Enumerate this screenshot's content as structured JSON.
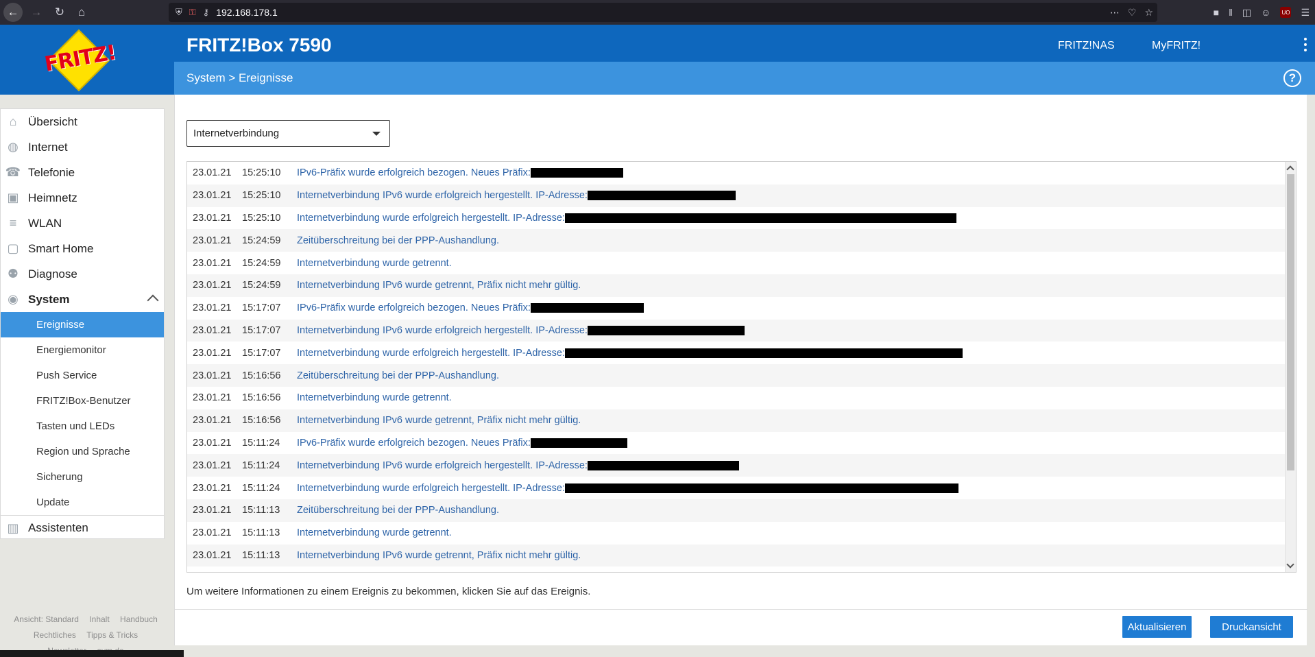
{
  "browser": {
    "url": "192.168.178.1"
  },
  "header": {
    "logo_text": "FRITZ!",
    "product": "FRITZ!Box 7590",
    "links": [
      "FRITZ!NAS",
      "MyFRITZ!"
    ],
    "breadcrumb": "System > Ereignisse",
    "help": "?"
  },
  "sidebar": {
    "items": [
      {
        "label": "Übersicht",
        "icon": "home-icon"
      },
      {
        "label": "Internet",
        "icon": "globe-icon"
      },
      {
        "label": "Telefonie",
        "icon": "phone-icon"
      },
      {
        "label": "Heimnetz",
        "icon": "network-icon"
      },
      {
        "label": "WLAN",
        "icon": "wifi-icon"
      },
      {
        "label": "Smart Home",
        "icon": "smarthome-icon"
      },
      {
        "label": "Diagnose",
        "icon": "diagnose-icon"
      },
      {
        "label": "System",
        "icon": "system-icon"
      }
    ],
    "subitems": [
      "Ereignisse",
      "Energiemonitor",
      "Push Service",
      "FRITZ!Box-Benutzer",
      "Tasten und LEDs",
      "Region und Sprache",
      "Sicherung",
      "Update"
    ],
    "assist": "Assistenten"
  },
  "footer": {
    "line1": [
      "Ansicht: Standard",
      "Inhalt",
      "Handbuch"
    ],
    "line2": [
      "Rechtliches",
      "Tipps & Tricks"
    ],
    "line3": [
      "Newsletter",
      "avm.de"
    ]
  },
  "filter": {
    "selected": "Internetverbindung"
  },
  "events": [
    {
      "date": "23.01.21",
      "time": "15:25:10",
      "msg": "IPv6-Präfix wurde erfolgreich bezogen. Neues Präfix:",
      "redact": 135
    },
    {
      "date": "23.01.21",
      "time": "15:25:10",
      "msg": "Internetverbindung IPv6 wurde erfolgreich hergestellt. IP-Adresse:",
      "redact": 216
    },
    {
      "date": "23.01.21",
      "time": "15:25:10",
      "msg": "Internetverbindung wurde erfolgreich hergestellt. IP-Adresse: ",
      "redact": 571
    },
    {
      "date": "23.01.21",
      "time": "15:24:59",
      "msg": "Zeitüberschreitung bei der PPP-Aushandlung.",
      "redact": 0
    },
    {
      "date": "23.01.21",
      "time": "15:24:59",
      "msg": "Internetverbindung wurde getrennt.",
      "redact": 0
    },
    {
      "date": "23.01.21",
      "time": "15:24:59",
      "msg": "Internetverbindung IPv6 wurde getrennt, Präfix nicht mehr gültig.",
      "redact": 0
    },
    {
      "date": "23.01.21",
      "time": "15:17:07",
      "msg": "IPv6-Präfix wurde erfolgreich bezogen. Neues Präfix:",
      "redact": 165
    },
    {
      "date": "23.01.21",
      "time": "15:17:07",
      "msg": "Internetverbindung IPv6 wurde erfolgreich hergestellt. IP-Adresse:",
      "redact": 229
    },
    {
      "date": "23.01.21",
      "time": "15:17:07",
      "msg": "Internetverbindung wurde erfolgreich hergestellt. IP-Adresse: ",
      "redact": 580
    },
    {
      "date": "23.01.21",
      "time": "15:16:56",
      "msg": "Zeitüberschreitung bei der PPP-Aushandlung.",
      "redact": 0
    },
    {
      "date": "23.01.21",
      "time": "15:16:56",
      "msg": "Internetverbindung wurde getrennt.",
      "redact": 0
    },
    {
      "date": "23.01.21",
      "time": "15:16:56",
      "msg": "Internetverbindung IPv6 wurde getrennt, Präfix nicht mehr gültig.",
      "redact": 0
    },
    {
      "date": "23.01.21",
      "time": "15:11:24",
      "msg": "IPv6-Präfix wurde erfolgreich bezogen. Neues Präfix:",
      "redact": 141
    },
    {
      "date": "23.01.21",
      "time": "15:11:24",
      "msg": "Internetverbindung IPv6 wurde erfolgreich hergestellt. IP-Adresse:",
      "redact": 221
    },
    {
      "date": "23.01.21",
      "time": "15:11:24",
      "msg": "Internetverbindung wurde erfolgreich hergestellt. IP-Adresse:",
      "redact": 574
    },
    {
      "date": "23.01.21",
      "time": "15:11:13",
      "msg": "Zeitüberschreitung bei der PPP-Aushandlung.",
      "redact": 0
    },
    {
      "date": "23.01.21",
      "time": "15:11:13",
      "msg": "Internetverbindung wurde getrennt.",
      "redact": 0
    },
    {
      "date": "23.01.21",
      "time": "15:11:13",
      "msg": "Internetverbindung IPv6 wurde getrennt, Präfix nicht mehr gültig.",
      "redact": 0
    }
  ],
  "hint": "Um weitere Informationen zu einem Ereignis zu bekommen, klicken Sie auf das Ereignis.",
  "buttons": {
    "refresh": "Aktualisieren",
    "print": "Druckansicht"
  },
  "colors": {
    "header": "#0e67bd",
    "subheader": "#3c93de",
    "active": "#3c93de",
    "button": "#1f7cd3",
    "link": "#2e64a8"
  }
}
